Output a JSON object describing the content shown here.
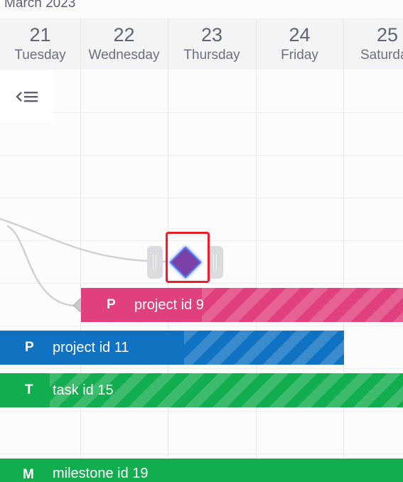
{
  "header": {
    "month_label": "March 2023",
    "days": [
      {
        "num": "21",
        "name": "Tuesday"
      },
      {
        "num": "22",
        "name": "Wednesday"
      },
      {
        "num": "23",
        "name": "Thursday"
      },
      {
        "num": "24",
        "name": "Friday"
      },
      {
        "num": "25",
        "name": "Saturday"
      }
    ]
  },
  "toolbar": {
    "collapse_icon": "collapse-list-icon"
  },
  "bars": [
    {
      "letter": "P",
      "label": "project id 9",
      "color": "#e0407e"
    },
    {
      "letter": "P",
      "label": "project id 11",
      "color": "#0f72c2"
    },
    {
      "letter": "T",
      "label": "task id 15",
      "color": "#12ad4e"
    },
    {
      "letter": "M",
      "label": "milestone id 19",
      "color": "#12ad4e"
    }
  ],
  "milestone": {
    "color": "#7b3fa8",
    "selected": true
  },
  "colors": {
    "header_bg": "#f2f4f6",
    "selection": "#e8202a",
    "link": "#cfd1d4"
  }
}
